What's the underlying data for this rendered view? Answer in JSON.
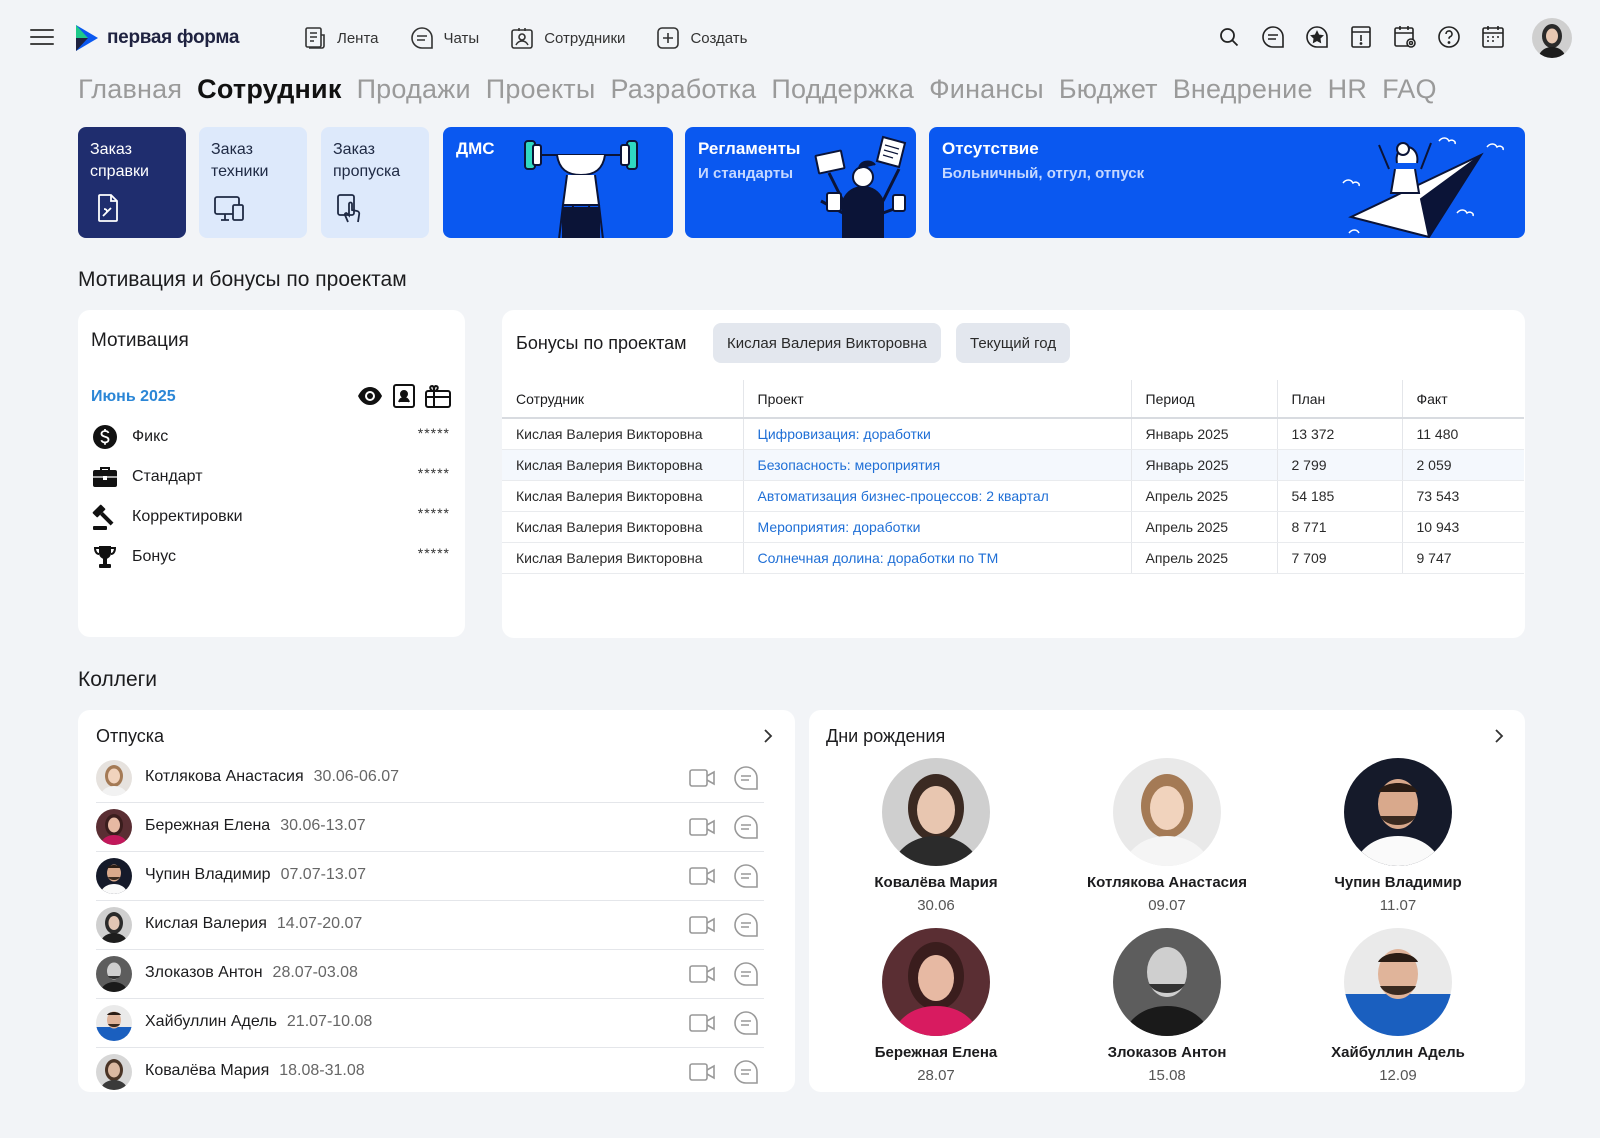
{
  "header": {
    "logo_text": "первая форма",
    "nav": [
      {
        "label": "Лента",
        "icon": "feed-icon"
      },
      {
        "label": "Чаты",
        "icon": "chat-icon"
      },
      {
        "label": "Сотрудники",
        "icon": "employees-icon"
      },
      {
        "label": "Создать",
        "icon": "plus-icon"
      }
    ],
    "icons": [
      "search-icon",
      "chat-bubble-icon",
      "favorites-icon",
      "notice-icon",
      "calendar-settings-icon",
      "help-icon",
      "calendar-icon"
    ]
  },
  "tabs": [
    "Главная",
    "Сотрудник",
    "Продажи",
    "Проекты",
    "Разработка",
    "Поддержка",
    "Финансы",
    "Бюджет",
    "Внедрение",
    "HR",
    "FAQ"
  ],
  "active_tab": "Сотрудник",
  "tiles": {
    "certificate": "Заказ справки",
    "equipment": "Заказ техники",
    "pass": "Заказ пропуска",
    "dms": "ДМС",
    "regulations": {
      "title": "Регламенты",
      "sub": "И стандарты"
    },
    "absence": {
      "title": "Отсутствие",
      "sub": "Больничный, отгул, отпуск"
    }
  },
  "motivation_section_title": "Мотивация и бонусы по проектам",
  "motivation": {
    "title": "Мотивация",
    "month": "Июнь 2025",
    "rows": [
      {
        "label": "Фикс",
        "value": "*****",
        "icon": "dollar-icon"
      },
      {
        "label": "Стандарт",
        "value": "*****",
        "icon": "briefcase-icon"
      },
      {
        "label": "Корректировки",
        "value": "*****",
        "icon": "gavel-icon"
      },
      {
        "label": "Бонус",
        "value": "*****",
        "icon": "trophy-icon"
      }
    ]
  },
  "bonuses": {
    "title": "Бонусы по проектам",
    "filter_person": "Кислая Валерия Викторовна",
    "filter_period": "Текущий год",
    "columns": [
      "Сотрудник",
      "Проект",
      "Период",
      "План",
      "Факт"
    ],
    "rows": [
      [
        "Кислая Валерия Викторовна",
        "Цифровизация: доработки",
        "Январь 2025",
        "13 372",
        "11 480"
      ],
      [
        "Кислая Валерия Викторовна",
        "Безопасность: мероприятия",
        "Январь 2025",
        "2 799",
        "2 059"
      ],
      [
        "Кислая Валерия Викторовна",
        "Автоматизация бизнес-процессов: 2 квартал",
        "Апрель 2025",
        "54 185",
        "73 543"
      ],
      [
        "Кислая Валерия Викторовна",
        "Мероприятия: доработки",
        "Апрель 2025",
        "8 771",
        "10 943"
      ],
      [
        "Кислая Валерия Викторовна",
        "Солнечная долина: доработки по ТМ",
        "Апрель 2025",
        "7 709",
        "9 747"
      ]
    ]
  },
  "colleagues_title": "Коллеги",
  "vacations": {
    "title": "Отпуска",
    "rows": [
      {
        "name": "Котлякова Анастасия",
        "dates": "30.06-06.07"
      },
      {
        "name": "Бережная Елена",
        "dates": "30.06-13.07"
      },
      {
        "name": "Чупин Владимир",
        "dates": "07.07-13.07"
      },
      {
        "name": "Кислая Валерия",
        "dates": "14.07-20.07"
      },
      {
        "name": "Злоказов Антон",
        "dates": "28.07-03.08"
      },
      {
        "name": "Хайбуллин Адель",
        "dates": "21.07-10.08"
      },
      {
        "name": "Ковалёва Мария",
        "dates": "18.08-31.08"
      }
    ]
  },
  "birthdays": {
    "title": "Дни рождения",
    "people": [
      {
        "name": "Ковалёва Мария",
        "date": "30.06"
      },
      {
        "name": "Котлякова Анастасия",
        "date": "09.07"
      },
      {
        "name": "Чупин Владимир",
        "date": "11.07"
      },
      {
        "name": "Бережная Елена",
        "date": "28.07"
      },
      {
        "name": "Злоказов Антон",
        "date": "15.08"
      },
      {
        "name": "Хайбуллин Адель",
        "date": "12.09"
      }
    ]
  },
  "colors": {
    "brand_blue": "#0a58f0",
    "dark_tile": "#1f2d6e",
    "light_tile": "#dde9fb",
    "link": "#1f6fd6",
    "month": "#2b86d6"
  }
}
